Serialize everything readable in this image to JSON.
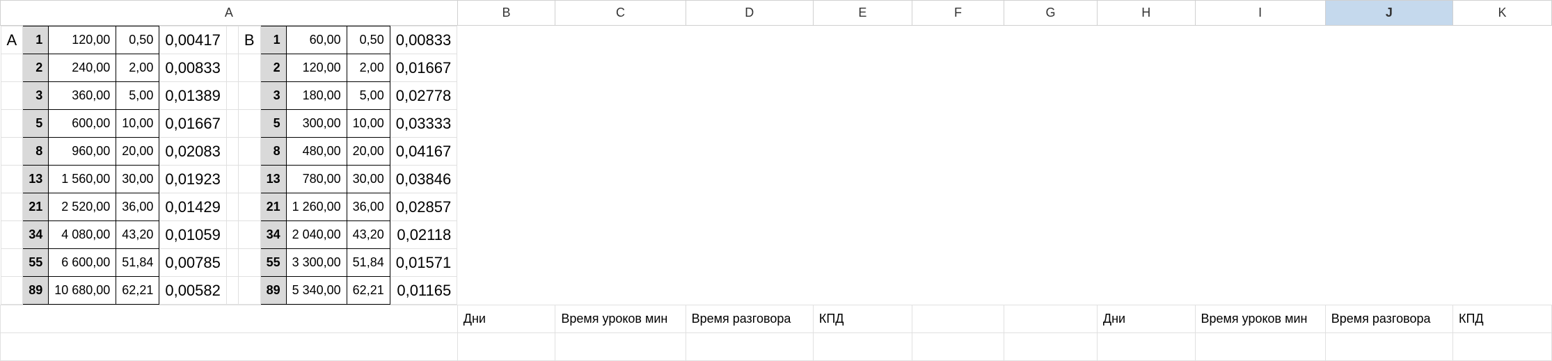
{
  "headers": [
    "A",
    "B",
    "C",
    "D",
    "E",
    "F",
    "G",
    "H",
    "I",
    "J",
    "K"
  ],
  "selected_header": "J",
  "rows": [
    {
      "A": "A",
      "B": "1",
      "C": "120,00",
      "D": "0,50",
      "E": "0,00417",
      "F": "",
      "G": "B",
      "H": "1",
      "I": "60,00",
      "J": "0,50",
      "K": "0,00833"
    },
    {
      "A": "",
      "B": "2",
      "C": "240,00",
      "D": "2,00",
      "E": "0,00833",
      "F": "",
      "G": "",
      "H": "2",
      "I": "120,00",
      "J": "2,00",
      "K": "0,01667"
    },
    {
      "A": "",
      "B": "3",
      "C": "360,00",
      "D": "5,00",
      "E": "0,01389",
      "F": "",
      "G": "",
      "H": "3",
      "I": "180,00",
      "J": "5,00",
      "K": "0,02778"
    },
    {
      "A": "",
      "B": "5",
      "C": "600,00",
      "D": "10,00",
      "E": "0,01667",
      "F": "",
      "G": "",
      "H": "5",
      "I": "300,00",
      "J": "10,00",
      "K": "0,03333"
    },
    {
      "A": "",
      "B": "8",
      "C": "960,00",
      "D": "20,00",
      "E": "0,02083",
      "F": "",
      "G": "",
      "H": "8",
      "I": "480,00",
      "J": "20,00",
      "K": "0,04167"
    },
    {
      "A": "",
      "B": "13",
      "C": "1 560,00",
      "D": "30,00",
      "E": "0,01923",
      "F": "",
      "G": "",
      "H": "13",
      "I": "780,00",
      "J": "30,00",
      "K": "0,03846"
    },
    {
      "A": "",
      "B": "21",
      "C": "2 520,00",
      "D": "36,00",
      "E": "0,01429",
      "F": "",
      "G": "",
      "H": "21",
      "I": "1 260,00",
      "J": "36,00",
      "K": "0,02857"
    },
    {
      "A": "",
      "B": "34",
      "C": "4 080,00",
      "D": "43,20",
      "E": "0,01059",
      "F": "",
      "G": "",
      "H": "34",
      "I": "2 040,00",
      "J": "43,20",
      "K": "0,02118"
    },
    {
      "A": "",
      "B": "55",
      "C": "6 600,00",
      "D": "51,84",
      "E": "0,00785",
      "F": "",
      "G": "",
      "H": "55",
      "I": "3 300,00",
      "J": "51,84",
      "K": "0,01571"
    },
    {
      "A": "",
      "B": "89",
      "C": "10 680,00",
      "D": "62,21",
      "E": "0,00582",
      "F": "",
      "G": "",
      "H": "89",
      "I": "5 340,00",
      "J": "62,21",
      "K": "0,01165"
    }
  ],
  "footer": {
    "A": "",
    "B": "Дни",
    "C": "Время уроков мин",
    "D": "Время разговора",
    "E": "КПД",
    "F": "",
    "G": "",
    "H": "Дни",
    "I": "Время уроков мин",
    "J": "Время разговора",
    "K": "КПД"
  },
  "chart_data": {
    "type": "table",
    "title": "",
    "datasets": [
      {
        "name": "A",
        "columns": [
          "Дни",
          "Время уроков мин",
          "Время разговора",
          "КПД"
        ],
        "data": [
          [
            1,
            120.0,
            0.5,
            0.00417
          ],
          [
            2,
            240.0,
            2.0,
            0.00833
          ],
          [
            3,
            360.0,
            5.0,
            0.01389
          ],
          [
            5,
            600.0,
            10.0,
            0.01667
          ],
          [
            8,
            960.0,
            20.0,
            0.02083
          ],
          [
            13,
            1560.0,
            30.0,
            0.01923
          ],
          [
            21,
            2520.0,
            36.0,
            0.01429
          ],
          [
            34,
            4080.0,
            43.2,
            0.01059
          ],
          [
            55,
            6600.0,
            51.84,
            0.00785
          ],
          [
            89,
            10680.0,
            62.21,
            0.00582
          ]
        ]
      },
      {
        "name": "B",
        "columns": [
          "Дни",
          "Время уроков мин",
          "Время разговора",
          "КПД"
        ],
        "data": [
          [
            1,
            60.0,
            0.5,
            0.00833
          ],
          [
            2,
            120.0,
            2.0,
            0.01667
          ],
          [
            3,
            180.0,
            5.0,
            0.02778
          ],
          [
            5,
            300.0,
            10.0,
            0.03333
          ],
          [
            8,
            480.0,
            20.0,
            0.04167
          ],
          [
            13,
            780.0,
            30.0,
            0.03846
          ],
          [
            21,
            1260.0,
            36.0,
            0.02857
          ],
          [
            34,
            2040.0,
            43.2,
            0.02118
          ],
          [
            55,
            3300.0,
            51.84,
            0.01571
          ],
          [
            89,
            5340.0,
            62.21,
            0.01165
          ]
        ]
      }
    ]
  }
}
